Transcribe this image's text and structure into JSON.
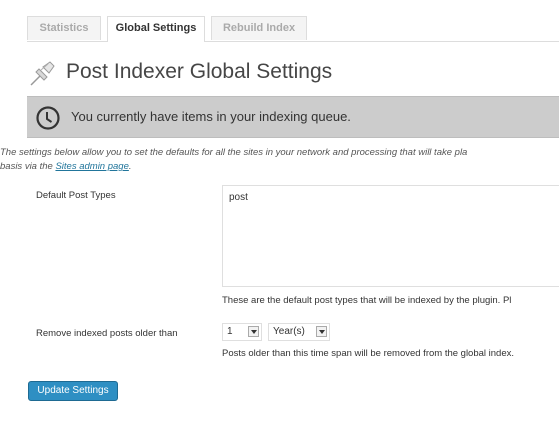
{
  "tabs": [
    {
      "label": "Statistics",
      "active": false
    },
    {
      "label": "Global Settings",
      "active": true
    },
    {
      "label": "Rebuild Index",
      "active": false
    }
  ],
  "page": {
    "title": "Post Indexer Global Settings"
  },
  "notice": {
    "text": "You currently have items in your indexing queue.",
    "icon": "clock-icon"
  },
  "description": {
    "text_before": "The settings below allow you to set the defaults for all the sites in your network and processing that will take pla",
    "text_line2": "basis via the ",
    "link": "Sites admin page",
    "text_after": "."
  },
  "form": {
    "post_types": {
      "label": "Default Post Types",
      "value": "post",
      "help": "These are the default post types that will be indexed by the plugin. Pl"
    },
    "remove_older": {
      "label": "Remove indexed posts older than",
      "number": "1",
      "unit": "Year(s)",
      "help": "Posts older than this time span will be removed from the global index."
    },
    "submit": "Update Settings"
  },
  "colors": {
    "accent": "#2e8fc3",
    "notice_bg": "#cccccc",
    "link": "#21759b"
  }
}
